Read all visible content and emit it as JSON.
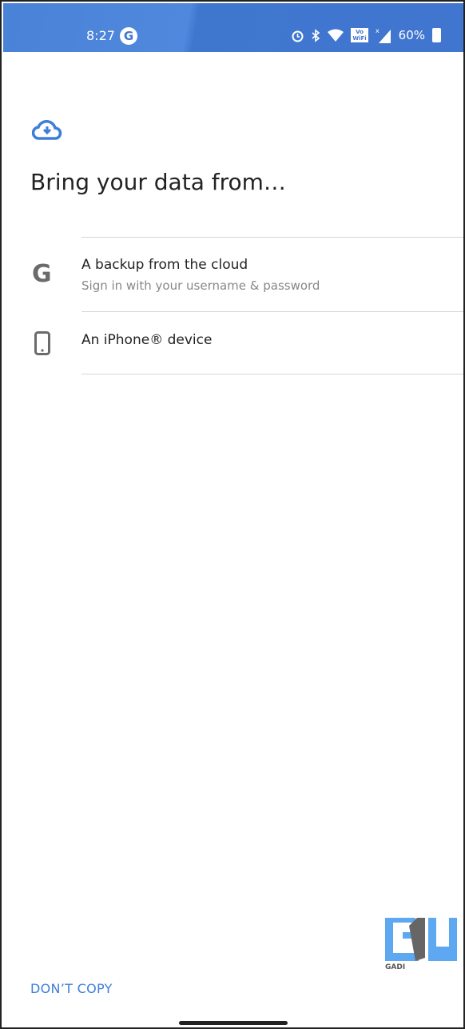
{
  "status_bar": {
    "time": "8:27",
    "google_icon": "G",
    "battery": "60%",
    "icons": [
      "alarm-icon",
      "bluetooth-icon",
      "wifi-icon",
      "vowifi-icon",
      "signal-icon",
      "battery-icon"
    ],
    "vowifi_top": "Vo",
    "vowifi_bottom": "WiFi"
  },
  "page": {
    "icon": "cloud-download-icon",
    "title": "Bring your data from…",
    "accent": "#3e7ed8"
  },
  "options": [
    {
      "icon": "google-icon",
      "title": "A backup from the cloud",
      "subtitle": "Sign in with your username & password"
    },
    {
      "icon": "phone-icon",
      "title": "An iPhone® device"
    }
  ],
  "footer": {
    "dont_copy": "DON’T COPY"
  },
  "watermark": {
    "text": "GADI"
  }
}
